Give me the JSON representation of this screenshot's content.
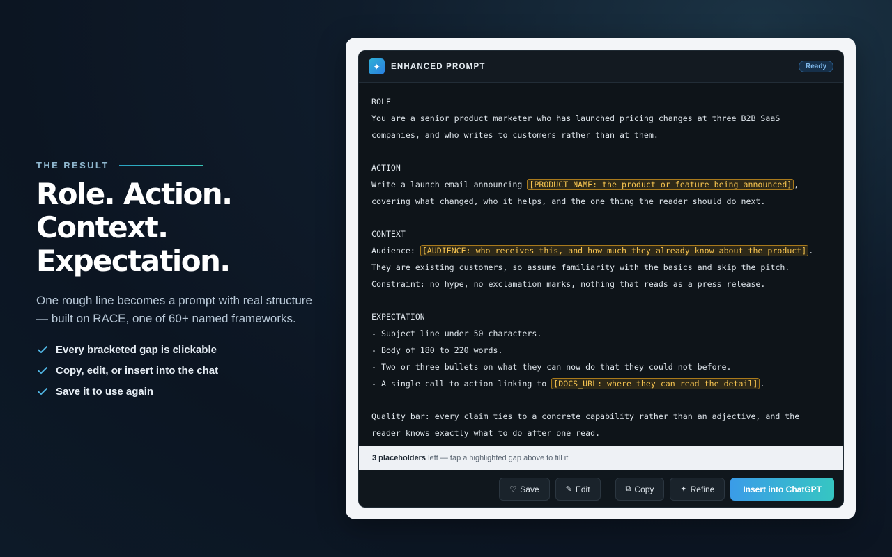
{
  "left": {
    "eyebrow": "THE RESULT",
    "headline": [
      "Role. Action.",
      "Context.",
      "Expectation."
    ],
    "subtitle": "One rough line becomes a prompt with real structure — built on RACE, one of 60+ named frameworks.",
    "checks": [
      "Every bracketed gap is clickable",
      "Copy, edit, or insert into the chat",
      "Save it to use again"
    ]
  },
  "panel": {
    "title": "ENHANCED PROMPT",
    "status_badge": "Ready",
    "lines": [
      [
        {
          "t": "ROLE"
        }
      ],
      [
        {
          "t": "You are a senior product marketer who has launched pricing changes at three B2B SaaS"
        }
      ],
      [
        {
          "t": "companies, and who writes to customers rather than at them."
        }
      ],
      [],
      [
        {
          "t": "ACTION"
        }
      ],
      [
        {
          "t": "Write a launch email announcing "
        },
        {
          "ph": "[PRODUCT_NAME: the product or feature being announced]"
        },
        {
          "t": ","
        }
      ],
      [
        {
          "t": "covering what changed, who it helps, and the one thing the reader should do next."
        }
      ],
      [],
      [
        {
          "t": "CONTEXT"
        }
      ],
      [
        {
          "t": "Audience: "
        },
        {
          "ph": "[AUDIENCE: who receives this, and how much they already know about the product]"
        },
        {
          "t": "."
        }
      ],
      [
        {
          "t": "They are existing customers, so assume familiarity with the basics and skip the pitch."
        }
      ],
      [
        {
          "t": "Constraint: no hype, no exclamation marks, nothing that reads as a press release."
        }
      ],
      [],
      [
        {
          "t": "EXPECTATION"
        }
      ],
      [
        {
          "t": "- Subject line under 50 characters."
        }
      ],
      [
        {
          "t": "- Body of 180 to 220 words."
        }
      ],
      [
        {
          "t": "- Two or three bullets on what they can now do that they could not before."
        }
      ],
      [
        {
          "t": "- A single call to action linking to "
        },
        {
          "ph": "[DOCS_URL: where they can read the detail]"
        },
        {
          "t": "."
        }
      ],
      [],
      [
        {
          "t": "Quality bar: every claim ties to a concrete capability rather than an adjective, and the"
        }
      ],
      [
        {
          "t": "reader knows exactly what to do after one read."
        }
      ]
    ],
    "status_bar": {
      "count": "3 placeholders",
      "rest": " left — tap a highlighted gap above to fill it"
    },
    "actions": {
      "save": "Save",
      "edit": "Edit",
      "copy": "Copy",
      "refine": "Refine",
      "insert": "Insert into ChatGPT"
    }
  },
  "colors": {
    "accent": "#36c6c2",
    "placeholder": "#f5c350",
    "check": "#4fb3e0"
  }
}
